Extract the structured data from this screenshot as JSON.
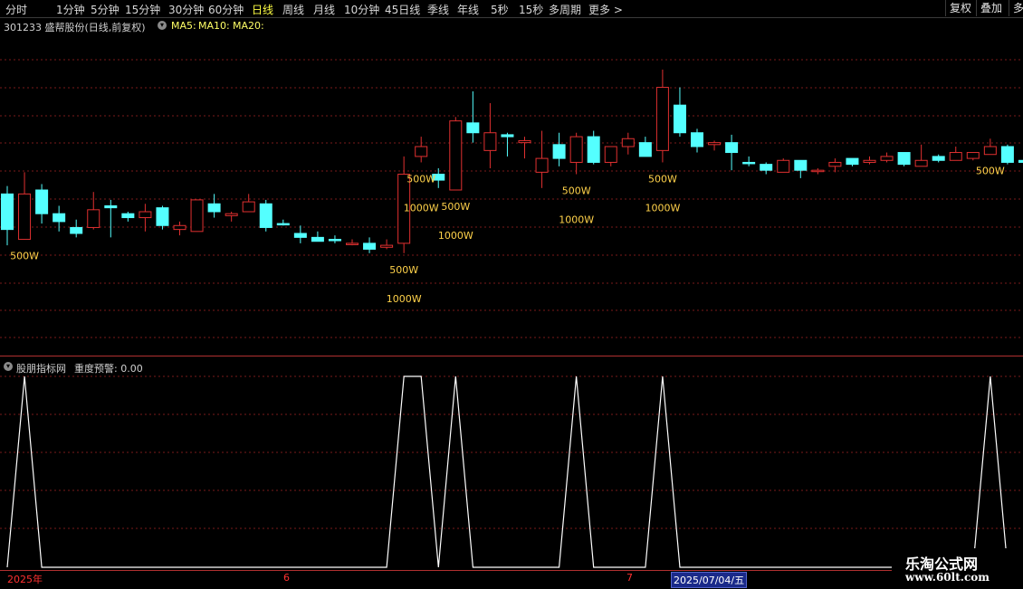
{
  "toolbar": {
    "tabs": [
      "分时",
      "1分钟",
      "5分钟",
      "15分钟",
      "30分钟",
      "60分钟",
      "日线",
      "周线",
      "月线",
      "10分钟",
      "45日线",
      "季线",
      "年线",
      "5秒",
      "15秒",
      "多周期",
      "更多 >"
    ],
    "active_tab": "日线",
    "right_buttons": [
      "复权",
      "叠加",
      "多"
    ]
  },
  "info": {
    "stock_title": "301233 盛帮股份(日线,前复权)",
    "ma5": "MA5:",
    "ma10": "MA10:",
    "ma20": "MA20:"
  },
  "indicator": {
    "title": "股朋指标网",
    "warning": "重度预警: 0.00"
  },
  "time_axis": {
    "year": "2025年",
    "month6": "6",
    "month7": "7",
    "cursor_date": "2025/07/04/五"
  },
  "watermark": {
    "title": "乐淘公式网",
    "url": "www.60lt.com"
  },
  "colors": {
    "up": "#e03030",
    "down": "#54ffff",
    "label": "#ffd24a",
    "grid": "#7a1a1a"
  },
  "chart_data": [
    {
      "type": "candlestick",
      "title": "301233 盛帮股份(日线,前复权)",
      "y_unit": "price (relative, no axis shown)",
      "candles": [
        {
          "o": 20.2,
          "h": 20.6,
          "l": 17.6,
          "c": 18.4,
          "dir": "down"
        },
        {
          "o": 17.9,
          "h": 21.3,
          "l": 17.9,
          "c": 20.2,
          "dir": "up"
        },
        {
          "o": 20.4,
          "h": 20.7,
          "l": 18.7,
          "c": 19.2,
          "dir": "down"
        },
        {
          "o": 19.2,
          "h": 19.6,
          "l": 18.3,
          "c": 18.8,
          "dir": "down"
        },
        {
          "o": 18.5,
          "h": 18.9,
          "l": 18.0,
          "c": 18.2,
          "dir": "down"
        },
        {
          "o": 18.5,
          "h": 20.3,
          "l": 18.4,
          "c": 19.4,
          "dir": "up"
        },
        {
          "o": 19.6,
          "h": 19.9,
          "l": 18.0,
          "c": 19.5,
          "dir": "down"
        },
        {
          "o": 19.2,
          "h": 19.3,
          "l": 18.8,
          "c": 19.0,
          "dir": "down"
        },
        {
          "o": 19.0,
          "h": 19.7,
          "l": 18.3,
          "c": 19.3,
          "dir": "up"
        },
        {
          "o": 19.5,
          "h": 19.6,
          "l": 18.4,
          "c": 18.6,
          "dir": "down"
        },
        {
          "o": 18.4,
          "h": 18.8,
          "l": 18.1,
          "c": 18.6,
          "dir": "up"
        },
        {
          "o": 18.3,
          "h": 19.9,
          "l": 18.3,
          "c": 19.9,
          "dir": "up"
        },
        {
          "o": 19.7,
          "h": 20.2,
          "l": 19.0,
          "c": 19.3,
          "dir": "down"
        },
        {
          "o": 19.2,
          "h": 19.3,
          "l": 18.8,
          "c": 19.1,
          "dir": "up"
        },
        {
          "o": 19.3,
          "h": 20.2,
          "l": 19.3,
          "c": 19.8,
          "dir": "up"
        },
        {
          "o": 19.7,
          "h": 19.9,
          "l": 18.3,
          "c": 18.5,
          "dir": "down"
        },
        {
          "o": 18.7,
          "h": 18.9,
          "l": 18.6,
          "c": 18.7,
          "dir": "down"
        },
        {
          "o": 18.2,
          "h": 18.6,
          "l": 17.7,
          "c": 18.0,
          "dir": "down"
        },
        {
          "o": 18.0,
          "h": 18.3,
          "l": 17.8,
          "c": 17.8,
          "dir": "down"
        },
        {
          "o": 17.9,
          "h": 18.1,
          "l": 17.7,
          "c": 17.9,
          "dir": "down"
        },
        {
          "o": 17.7,
          "h": 17.9,
          "l": 17.6,
          "c": 17.7,
          "dir": "up"
        },
        {
          "o": 17.7,
          "h": 18.0,
          "l": 17.2,
          "c": 17.4,
          "dir": "down"
        },
        {
          "o": 17.5,
          "h": 17.9,
          "l": 17.4,
          "c": 17.6,
          "dir": "up"
        },
        {
          "o": 17.7,
          "h": 22.1,
          "l": 17.2,
          "c": 21.2,
          "dir": "up"
        },
        {
          "o": 22.1,
          "h": 23.1,
          "l": 21.8,
          "c": 22.6,
          "dir": "up"
        },
        {
          "o": 21.2,
          "h": 21.5,
          "l": 20.5,
          "c": 20.9,
          "dir": "down"
        },
        {
          "o": 20.4,
          "h": 24.1,
          "l": 20.4,
          "c": 23.9,
          "dir": "up"
        },
        {
          "o": 23.8,
          "h": 25.4,
          "l": 22.8,
          "c": 23.3,
          "dir": "down"
        },
        {
          "o": 22.4,
          "h": 24.8,
          "l": 21.5,
          "c": 23.3,
          "dir": "up"
        },
        {
          "o": 23.1,
          "h": 23.3,
          "l": 22.1,
          "c": 23.2,
          "dir": "down"
        },
        {
          "o": 22.8,
          "h": 23.1,
          "l": 22.0,
          "c": 22.9,
          "dir": "up"
        },
        {
          "o": 21.3,
          "h": 23.4,
          "l": 20.5,
          "c": 22.0,
          "dir": "up"
        },
        {
          "o": 22.7,
          "h": 23.3,
          "l": 21.6,
          "c": 22.0,
          "dir": "down"
        },
        {
          "o": 21.8,
          "h": 23.3,
          "l": 21.2,
          "c": 23.1,
          "dir": "up"
        },
        {
          "o": 23.1,
          "h": 23.4,
          "l": 21.7,
          "c": 21.8,
          "dir": "down"
        },
        {
          "o": 21.8,
          "h": 22.6,
          "l": 21.6,
          "c": 22.6,
          "dir": "up"
        },
        {
          "o": 22.6,
          "h": 23.3,
          "l": 22.2,
          "c": 23.0,
          "dir": "up"
        },
        {
          "o": 22.8,
          "h": 23.1,
          "l": 22.1,
          "c": 22.1,
          "dir": "down"
        },
        {
          "o": 22.4,
          "h": 26.5,
          "l": 21.8,
          "c": 25.6,
          "dir": "up"
        },
        {
          "o": 24.7,
          "h": 25.6,
          "l": 23.1,
          "c": 23.3,
          "dir": "down"
        },
        {
          "o": 23.3,
          "h": 23.5,
          "l": 22.3,
          "c": 22.6,
          "dir": "down"
        },
        {
          "o": 22.7,
          "h": 22.9,
          "l": 22.4,
          "c": 22.8,
          "dir": "up"
        },
        {
          "o": 22.8,
          "h": 23.2,
          "l": 21.4,
          "c": 22.3,
          "dir": "down"
        },
        {
          "o": 21.8,
          "h": 22.1,
          "l": 21.6,
          "c": 21.8,
          "dir": "down"
        },
        {
          "o": 21.7,
          "h": 21.8,
          "l": 21.2,
          "c": 21.4,
          "dir": "down"
        },
        {
          "o": 21.3,
          "h": 22.0,
          "l": 21.3,
          "c": 21.9,
          "dir": "up"
        },
        {
          "o": 21.9,
          "h": 21.9,
          "l": 21.0,
          "c": 21.4,
          "dir": "down"
        },
        {
          "o": 21.4,
          "h": 21.5,
          "l": 21.2,
          "c": 21.4,
          "dir": "up"
        },
        {
          "o": 21.6,
          "h": 22.0,
          "l": 21.3,
          "c": 21.8,
          "dir": "up"
        },
        {
          "o": 22.0,
          "h": 22.0,
          "l": 21.6,
          "c": 21.7,
          "dir": "down"
        },
        {
          "o": 21.8,
          "h": 22.1,
          "l": 21.7,
          "c": 21.9,
          "dir": "up"
        },
        {
          "o": 21.9,
          "h": 22.3,
          "l": 21.8,
          "c": 22.1,
          "dir": "up"
        },
        {
          "o": 22.3,
          "h": 22.3,
          "l": 21.6,
          "c": 21.7,
          "dir": "down"
        },
        {
          "o": 21.6,
          "h": 22.7,
          "l": 21.6,
          "c": 21.9,
          "dir": "up"
        },
        {
          "o": 22.1,
          "h": 22.2,
          "l": 21.8,
          "c": 21.9,
          "dir": "down"
        },
        {
          "o": 21.9,
          "h": 22.6,
          "l": 21.9,
          "c": 22.3,
          "dir": "up"
        },
        {
          "o": 22.0,
          "h": 22.3,
          "l": 21.9,
          "c": 22.3,
          "dir": "up"
        },
        {
          "o": 22.2,
          "h": 23.0,
          "l": 22.2,
          "c": 22.6,
          "dir": "up"
        },
        {
          "o": 22.6,
          "h": 22.7,
          "l": 21.7,
          "c": 21.8,
          "dir": "down"
        },
        {
          "o": 21.9,
          "h": 22.0,
          "l": 21.6,
          "c": 21.8,
          "dir": "down"
        }
      ],
      "annotations": [
        {
          "candle": 1,
          "texts": [
            "500W"
          ]
        },
        {
          "candle": 23,
          "texts": [
            "500W",
            "1000W"
          ]
        },
        {
          "candle": 24,
          "texts": [
            "500W",
            "1000W"
          ]
        },
        {
          "candle": 26,
          "texts": [
            "500W",
            "1000W"
          ]
        },
        {
          "candle": 33,
          "texts": [
            "500W",
            "1000W"
          ]
        },
        {
          "candle": 38,
          "texts": [
            "500W",
            "1000W"
          ]
        },
        {
          "candle": 57,
          "texts": [
            "500W"
          ]
        }
      ]
    },
    {
      "type": "line",
      "title": "股朋指标网",
      "series": [
        {
          "values": [
            0,
            1,
            0,
            0,
            0,
            0,
            0,
            0,
            0,
            0,
            0,
            0,
            0,
            0,
            0,
            0,
            0,
            0,
            0,
            0,
            0,
            0,
            0,
            1,
            1,
            0,
            1,
            0,
            0,
            0,
            0,
            0,
            0,
            1,
            0,
            0,
            0,
            0,
            1,
            0,
            0,
            0,
            0,
            0,
            0,
            0,
            0,
            0,
            0,
            0,
            0,
            0,
            0,
            0,
            0,
            0,
            0,
            1,
            0
          ]
        }
      ]
    }
  ]
}
